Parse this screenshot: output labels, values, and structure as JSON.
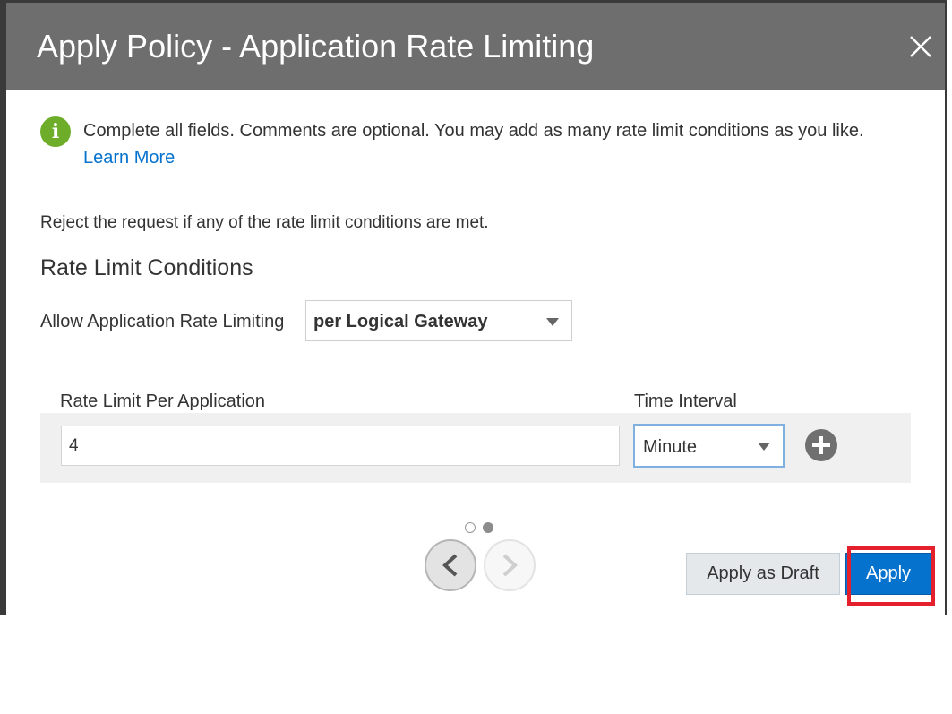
{
  "dialog": {
    "title": "Apply Policy - Application Rate Limiting",
    "close_icon": "close-icon"
  },
  "info": {
    "icon": "info-icon",
    "icon_glyph": "i",
    "text": "Complete all fields. Comments are optional. You may add as many rate limit conditions as you like.",
    "link": "Learn More"
  },
  "body": {
    "reject_text": "Reject the request if any of the rate limit conditions are met.",
    "section_title": "Rate Limit Conditions",
    "allow_label": "Allow Application Rate Limiting",
    "allow_value": "per Logical Gateway"
  },
  "condition": {
    "rate_label": "Rate Limit Per Application",
    "rate_value": "4",
    "interval_label": "Time Interval",
    "interval_value": "Minute",
    "add_icon": "plus-circle-icon"
  },
  "pager": {
    "pages": 2,
    "current": 2
  },
  "buttons": {
    "draft": "Apply as Draft",
    "apply": "Apply"
  },
  "colors": {
    "header": "#6e6e6e",
    "accent": "#0572ce",
    "info_icon": "#6dad2a",
    "highlight": "#e3202b"
  }
}
